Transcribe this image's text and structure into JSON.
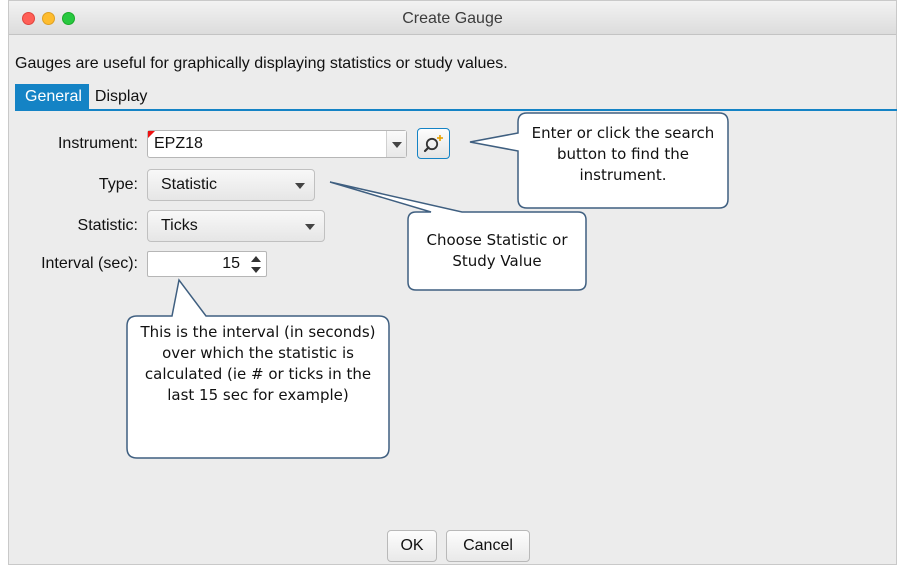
{
  "window": {
    "title": "Create Gauge"
  },
  "description": "Gauges are useful for graphically displaying statistics or study values.",
  "tabs": [
    {
      "label": "General",
      "active": true
    },
    {
      "label": "Display",
      "active": false
    }
  ],
  "form": {
    "instrument_label": "Instrument:",
    "instrument_value": "EPZ18",
    "type_label": "Type:",
    "type_value": "Statistic",
    "statistic_label": "Statistic:",
    "statistic_value": "Ticks",
    "interval_label": "Interval (sec):",
    "interval_value": "15"
  },
  "callouts": {
    "search": "Enter or click the search button to find the instrument.",
    "type": "Choose Statistic or Study Value",
    "interval": "This is the interval (in seconds) over which the statistic is calculated (ie # or ticks in the last 15 sec for example)"
  },
  "buttons": {
    "ok": "OK",
    "cancel": "Cancel"
  },
  "colors": {
    "accent": "#1483c5",
    "callout_border": "#3f5f80",
    "required_marker": "#e11111"
  },
  "icons": [
    "close-window-icon",
    "minimize-window-icon",
    "zoom-window-icon",
    "chevron-down-icon",
    "search-icon",
    "stepper-icon"
  ]
}
